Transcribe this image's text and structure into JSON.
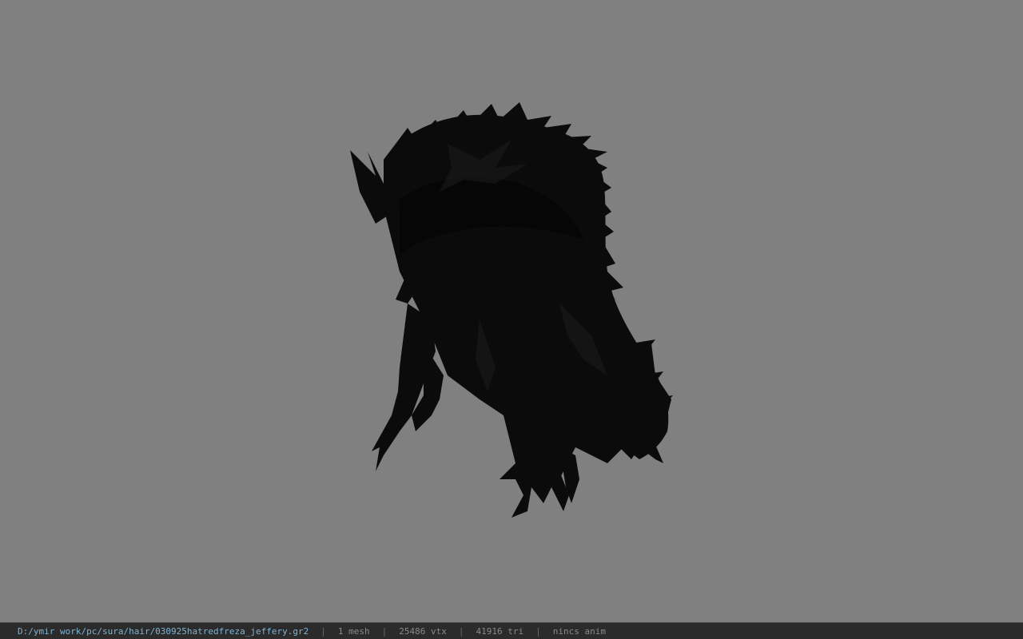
{
  "viewport": {
    "background_color": "#808080",
    "model_color": "#0b0b0b",
    "model_description_icon": "hair-model-icon"
  },
  "statusbar": {
    "file_path": "D:/ymir work/pc/sura/hair/030925hatredfreza_jeffery.gr2",
    "separator": "|",
    "mesh_count": "1 mesh",
    "vertex_count": "25486 vtx",
    "triangle_count": "41916 tri",
    "anim_status": "nincs anim",
    "path_color": "#7fb3d5",
    "background_color": "#2b2b2b"
  }
}
